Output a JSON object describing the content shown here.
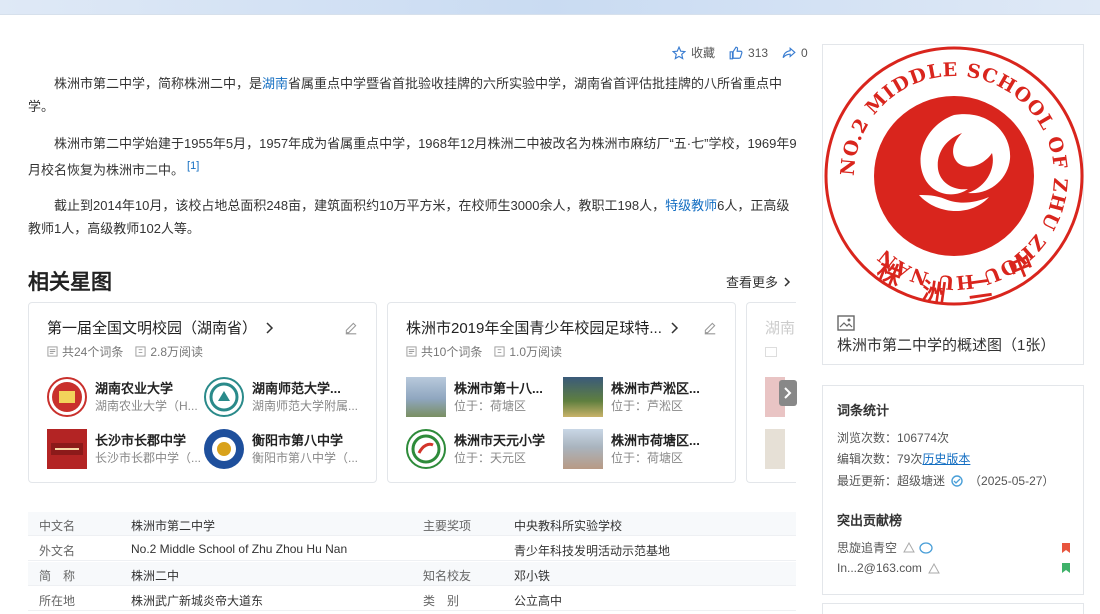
{
  "actions": {
    "favorite_label": "收藏",
    "like_count": "313",
    "share_count": "0"
  },
  "intro": {
    "p1_before": "株洲市第二中学，简称株洲二中，是",
    "p1_link": "湖南",
    "p1_after": "省属重点中学暨省首批验收挂牌的六所实验中学，湖南省首评估批挂牌的八所省重点中学。",
    "p2": "株洲市第二中学始建于1955年5月，1957年成为省属重点中学，1968年12月株洲二中被改名为株洲市麻纺厂“五·七”学校，1969年9月校名恢复为株洲市二中。",
    "p2_ref": "[1]",
    "p3_before": "截止到2014年10月，该校占地总面积248亩，建筑面积约10万平方米，在校师生3000余人，教职工198人，",
    "p3_link": "特级教师",
    "p3_after": "6人，正高级教师1人，高级教师102人等。"
  },
  "related": {
    "title": "相关星图",
    "more_label": "查看更多",
    "cards": [
      {
        "title": "第一届全国文明校园（湖南省）",
        "entries": "共24个词条",
        "reads": "2.8万阅读",
        "items": [
          {
            "name": "湖南农业大学",
            "sub": "湖南农业大学（H..."
          },
          {
            "name": "湖南师范大学...",
            "sub": "湖南师范大学附属..."
          },
          {
            "name": "长沙市长郡中学",
            "sub": "长沙市长郡中学（..."
          },
          {
            "name": "衡阳市第八中学",
            "sub": "衡阳市第八中学（..."
          }
        ]
      },
      {
        "title": "株洲市2019年全国青少年校园足球特...",
        "entries": "共10个词条",
        "reads": "1.0万阅读",
        "items": [
          {
            "name": "株洲市第十八...",
            "sub": "位于：荷塘区"
          },
          {
            "name": "株洲市芦淞区...",
            "sub": "位于：芦淞区"
          },
          {
            "name": "株洲市天元小学",
            "sub": "位于：天元区"
          },
          {
            "name": "株洲市荷塘区...",
            "sub": "位于：荷塘区"
          }
        ]
      },
      {
        "title": "湖南"
      }
    ]
  },
  "info_rows": [
    {
      "k1": "中文名",
      "v1": "株洲市第二中学",
      "k2": "主要奖项",
      "v2": "中央教科所实验学校"
    },
    {
      "k1": "外文名",
      "v1": "No.2 Middle School of Zhu Zhou Hu Nan",
      "k2": "",
      "v2": "青少年科技发明活动示范基地"
    },
    {
      "k1": "简　称",
      "v1": "株洲二中",
      "k2": "知名校友",
      "v2": "邓小铁"
    },
    {
      "k1": "所在地",
      "v1": "株洲武广新城炎帝大道东",
      "k2": "类　别",
      "v2": "公立高中"
    }
  ],
  "logo": {
    "ring_text": "NO.2 MIDDLE SCHOOL OF ZHU ZHOU HU NAN",
    "chars": [
      "株",
      "洲",
      "二",
      "中"
    ],
    "caption": "株洲市第二中学的概述图（1张）",
    "color": "#d9251d"
  },
  "stats": {
    "title": "词条统计",
    "views": "浏览次数：106774次",
    "edits_before": "编辑次数：79次",
    "edits_link": "历史版本",
    "updated_label": "最近更新：",
    "updated_user": "超级塘迷",
    "updated_date": "（2025-05-27）",
    "contrib_title": "突出贡献榜",
    "contributors": [
      "思旋追青空",
      "In...2@163.com"
    ]
  }
}
